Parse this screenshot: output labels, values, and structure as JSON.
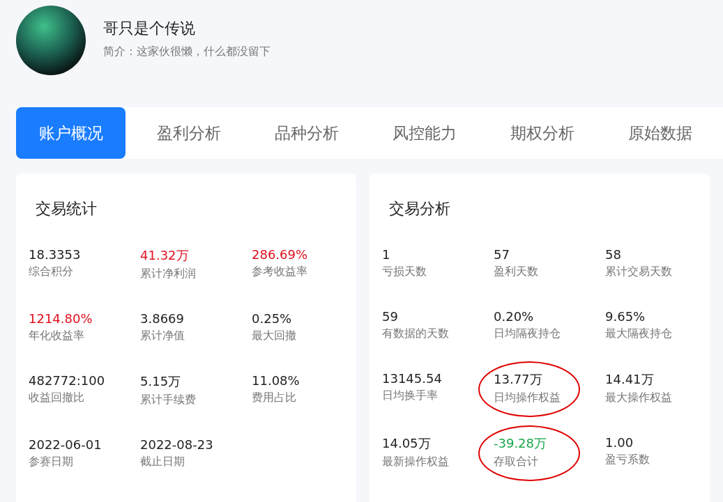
{
  "profile": {
    "name": "哥只是个传说",
    "bio": "简介：这家伙很懒，什么都没留下"
  },
  "tabs": [
    {
      "label": "账户概况",
      "selected": true
    },
    {
      "label": "盈利分析",
      "selected": false
    },
    {
      "label": "品种分析",
      "selected": false
    },
    {
      "label": "风控能力",
      "selected": false
    },
    {
      "label": "期权分析",
      "selected": false
    },
    {
      "label": "原始数据",
      "selected": false
    }
  ],
  "cards": [
    {
      "title": "交易统计",
      "stats": [
        {
          "value": "18.3353",
          "label": "综合积分",
          "kind": "plain",
          "circled": false
        },
        {
          "value": "41.32万",
          "label": "累计净利润",
          "kind": "gain",
          "circled": false
        },
        {
          "value": "286.69%",
          "label": "参考收益率",
          "kind": "gain",
          "circled": false
        },
        {
          "value": "1214.80%",
          "label": "年化收益率",
          "kind": "gain",
          "circled": false
        },
        {
          "value": "3.8669",
          "label": "累计净值",
          "kind": "plain",
          "circled": false
        },
        {
          "value": "0.25%",
          "label": "最大回撤",
          "kind": "plain",
          "circled": false
        },
        {
          "value": "482772:100",
          "label": "收益回撤比",
          "kind": "plain",
          "circled": false
        },
        {
          "value": "5.15万",
          "label": "累计手续费",
          "kind": "plain",
          "circled": false
        },
        {
          "value": "11.08%",
          "label": "费用占比",
          "kind": "plain",
          "circled": false
        },
        {
          "value": "2022-06-01",
          "label": "参赛日期",
          "kind": "plain",
          "circled": false
        },
        {
          "value": "2022-08-23",
          "label": "截止日期",
          "kind": "plain",
          "circled": false
        }
      ]
    },
    {
      "title": "交易分析",
      "stats": [
        {
          "value": "1",
          "label": "亏损天数",
          "kind": "plain",
          "circled": false
        },
        {
          "value": "57",
          "label": "盈利天数",
          "kind": "plain",
          "circled": false
        },
        {
          "value": "58",
          "label": "累计交易天数",
          "kind": "plain",
          "circled": false
        },
        {
          "value": "59",
          "label": "有数据的天数",
          "kind": "plain",
          "circled": false
        },
        {
          "value": "0.20%",
          "label": "日均隔夜持仓",
          "kind": "plain",
          "circled": false
        },
        {
          "value": "9.65%",
          "label": "最大隔夜持仓",
          "kind": "plain",
          "circled": false
        },
        {
          "value": "13145.54",
          "label": "日均换手率",
          "kind": "plain",
          "circled": false
        },
        {
          "value": "13.77万",
          "label": "日均操作权益",
          "kind": "plain",
          "circled": true
        },
        {
          "value": "14.41万",
          "label": "最大操作权益",
          "kind": "plain",
          "circled": false
        },
        {
          "value": "14.05万",
          "label": "最新操作权益",
          "kind": "plain",
          "circled": false
        },
        {
          "value": "-39.28万",
          "label": "存取合计",
          "kind": "loss",
          "circled": true
        },
        {
          "value": "1.00",
          "label": "盈亏系数",
          "kind": "plain",
          "circled": false
        }
      ]
    }
  ]
}
